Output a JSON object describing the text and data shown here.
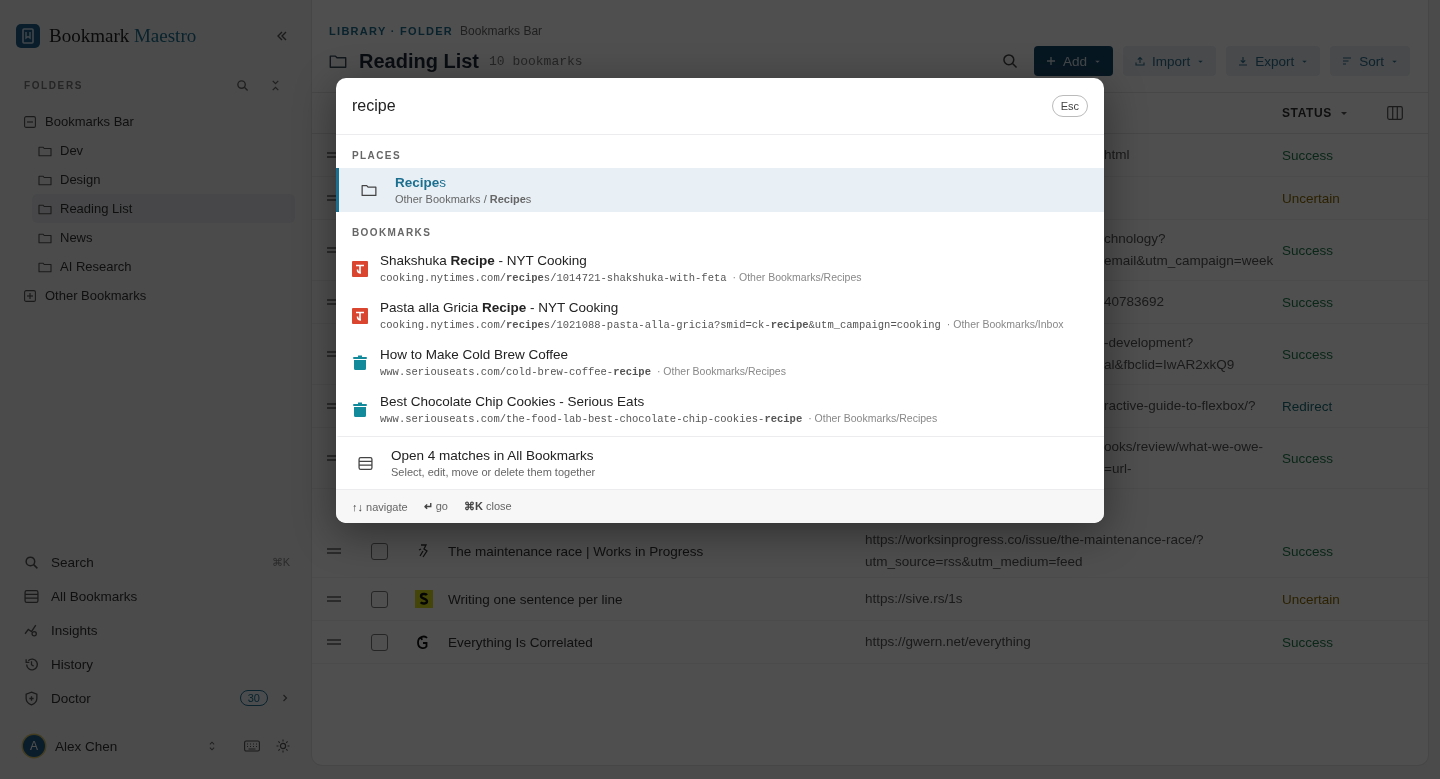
{
  "sidebar": {
    "brand": {
      "name": "Bookmark",
      "accent": "Maestro"
    },
    "folders_label": "FOLDERS",
    "folders": [
      {
        "label": "Bookmarks Bar",
        "expanded": true,
        "children": [
          {
            "label": "Dev",
            "selected": false
          },
          {
            "label": "Design",
            "selected": false
          },
          {
            "label": "Reading List",
            "selected": true
          },
          {
            "label": "News",
            "selected": false
          },
          {
            "label": "AI Research",
            "selected": false
          }
        ]
      },
      {
        "label": "Other Bookmarks",
        "expanded": false
      }
    ],
    "nav": [
      {
        "kind": "search",
        "label": "Search",
        "shortcut": "⌘K"
      },
      {
        "kind": "all",
        "label": "All Bookmarks"
      },
      {
        "kind": "insights",
        "label": "Insights"
      },
      {
        "kind": "history",
        "label": "History"
      },
      {
        "kind": "doctor",
        "label": "Doctor",
        "badge": "30"
      }
    ],
    "user": {
      "initial": "A",
      "name": "Alex Chen"
    }
  },
  "main": {
    "breadcrumb": {
      "path": "LIBRARY · FOLDER",
      "current": "Bookmarks Bar"
    },
    "title": "Reading List",
    "count": "10 bookmarks",
    "buttons": [
      {
        "kind": "add",
        "label": "Add"
      },
      {
        "kind": "import",
        "label": "Import"
      },
      {
        "kind": "export",
        "label": "Export"
      },
      {
        "kind": "sort",
        "label": "Sort"
      }
    ],
    "table": {
      "status_column": "STATUS",
      "rows": [
        {
          "url": "html",
          "status": {
            "label": "Success",
            "kind": "success"
          }
        },
        {
          "status": {
            "label": "Uncertain",
            "kind": "uncertain"
          }
        },
        {
          "url": "chnology?\nemail&utm_campaign=week",
          "status": {
            "label": "Success",
            "kind": "success"
          }
        },
        {
          "url": "40783692",
          "status": {
            "label": "Success",
            "kind": "success"
          }
        },
        {
          "url": "-development?\nal&fbclid=IwAR2xkQ9",
          "status": {
            "label": "Success",
            "kind": "success"
          }
        },
        {
          "url": "ractive-guide-to-flexbox/?",
          "status": {
            "label": "Redirect",
            "kind": "redirect"
          }
        },
        {
          "url": "ooks/review/what-we-owe-\n=url-",
          "status": {
            "label": "Success",
            "kind": "success"
          }
        },
        {
          "kind": "figure",
          "checked": false,
          "title": "The maintenance race | Works in Progress",
          "url": "https://worksinprogress.co/issue/the-maintenance-race/?\nutm_source=rss&utm_medium=feed",
          "status": {
            "label": "Success",
            "kind": "success"
          }
        },
        {
          "kind": "square",
          "checked": false,
          "title": "Writing one sentence per line",
          "url": "https://sive.rs/1s",
          "status": {
            "label": "Uncertain",
            "kind": "uncertain"
          }
        },
        {
          "kind": "swirl",
          "checked": false,
          "title": "Everything Is Correlated",
          "url": "https://gwern.net/everything",
          "status": {
            "label": "Success",
            "kind": "success"
          }
        }
      ]
    }
  },
  "palette": {
    "query": "recipe",
    "esc": "Esc",
    "sections": [
      {
        "label": "PLACES",
        "items": [
          {
            "kind": "folder",
            "selected": true,
            "title": "**Recipe**s",
            "subtitle": "Other Bookmarks / **Recipe**s"
          }
        ]
      },
      {
        "label": "BOOKMARKS",
        "items": [
          {
            "kind": "newspaper",
            "selected": false,
            "title": "Shakshuka **Recipe** - NYT Cooking",
            "url": "cooking.nytimes.com/**recipe**s/1014721-shakshuka-with-feta",
            "folder": "· Other Bookmarks/Recipes"
          },
          {
            "kind": "newspaper",
            "selected": false,
            "title": "Pasta alla Gricia **Recipe** - NYT Cooking",
            "url": "cooking.nytimes.com/**recipe**s/1021088-pasta-alla-gricia?smid=ck-**recipe**&utm_campaign=cooking",
            "folder": "· Other Bookmarks/Inbox"
          },
          {
            "kind": "pot",
            "selected": false,
            "title": "How to Make Cold Brew Coffee",
            "url": "www.seriouseats.com/cold-brew-coffee-**recipe**",
            "folder": "· Other Bookmarks/Recipes"
          },
          {
            "kind": "pot",
            "selected": false,
            "title": "Best Chocolate Chip Cookies - Serious Eats",
            "url": "www.seriouseats.com/the-food-lab-best-chocolate-chip-cookies-**recipe**",
            "folder": "· Other Bookmarks/Recipes"
          }
        ]
      }
    ],
    "action": {
      "title": "Open 4 matches in All Bookmarks",
      "subtitle": "Select, edit, move or delete them together"
    },
    "hints": [
      {
        "key": "↑↓",
        "label": "navigate"
      },
      {
        "key": "↵",
        "label": "go"
      },
      {
        "key": "⌘K",
        "label": "close"
      }
    ]
  }
}
